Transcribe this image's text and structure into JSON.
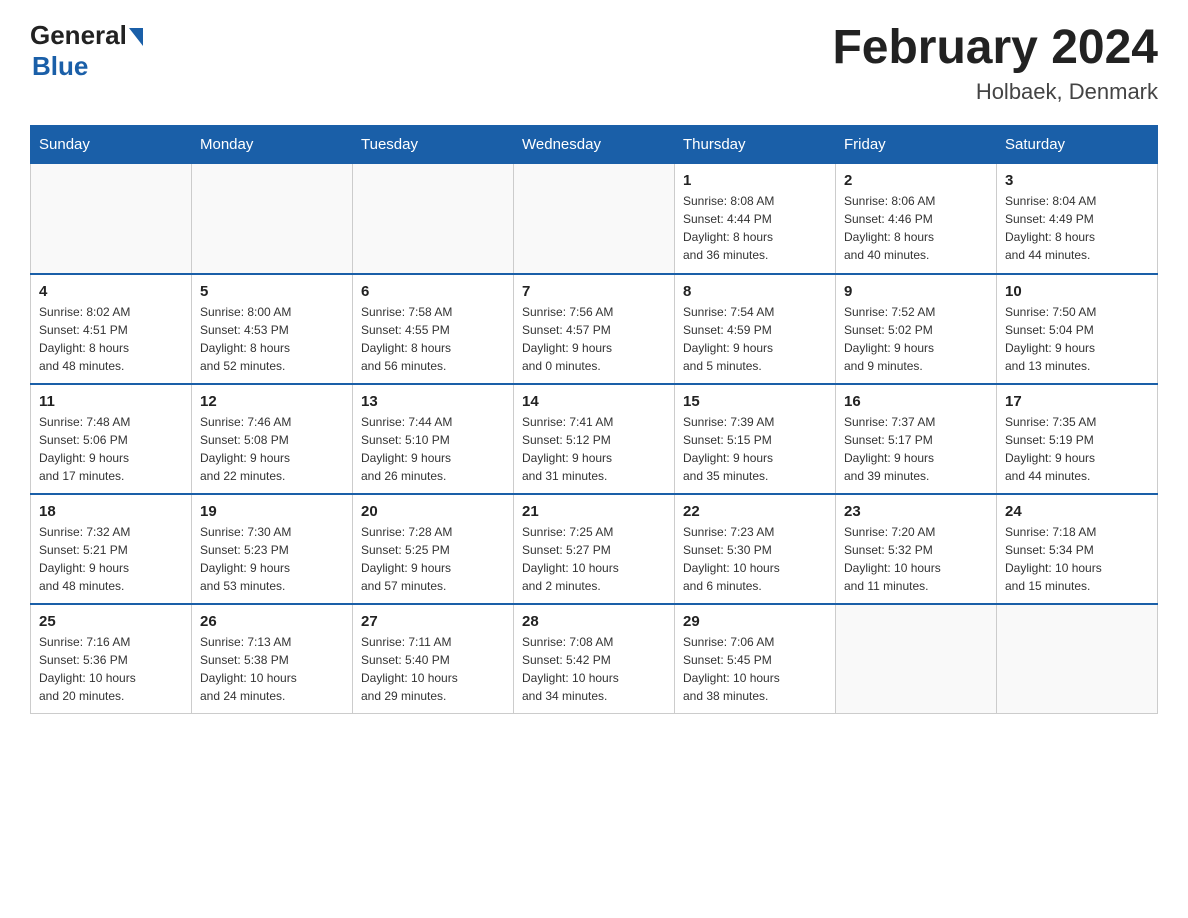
{
  "header": {
    "logo_general": "General",
    "logo_blue": "Blue",
    "title": "February 2024",
    "subtitle": "Holbaek, Denmark"
  },
  "weekdays": [
    "Sunday",
    "Monday",
    "Tuesday",
    "Wednesday",
    "Thursday",
    "Friday",
    "Saturday"
  ],
  "weeks": [
    [
      {
        "day": "",
        "info": ""
      },
      {
        "day": "",
        "info": ""
      },
      {
        "day": "",
        "info": ""
      },
      {
        "day": "",
        "info": ""
      },
      {
        "day": "1",
        "info": "Sunrise: 8:08 AM\nSunset: 4:44 PM\nDaylight: 8 hours\nand 36 minutes."
      },
      {
        "day": "2",
        "info": "Sunrise: 8:06 AM\nSunset: 4:46 PM\nDaylight: 8 hours\nand 40 minutes."
      },
      {
        "day": "3",
        "info": "Sunrise: 8:04 AM\nSunset: 4:49 PM\nDaylight: 8 hours\nand 44 minutes."
      }
    ],
    [
      {
        "day": "4",
        "info": "Sunrise: 8:02 AM\nSunset: 4:51 PM\nDaylight: 8 hours\nand 48 minutes."
      },
      {
        "day": "5",
        "info": "Sunrise: 8:00 AM\nSunset: 4:53 PM\nDaylight: 8 hours\nand 52 minutes."
      },
      {
        "day": "6",
        "info": "Sunrise: 7:58 AM\nSunset: 4:55 PM\nDaylight: 8 hours\nand 56 minutes."
      },
      {
        "day": "7",
        "info": "Sunrise: 7:56 AM\nSunset: 4:57 PM\nDaylight: 9 hours\nand 0 minutes."
      },
      {
        "day": "8",
        "info": "Sunrise: 7:54 AM\nSunset: 4:59 PM\nDaylight: 9 hours\nand 5 minutes."
      },
      {
        "day": "9",
        "info": "Sunrise: 7:52 AM\nSunset: 5:02 PM\nDaylight: 9 hours\nand 9 minutes."
      },
      {
        "day": "10",
        "info": "Sunrise: 7:50 AM\nSunset: 5:04 PM\nDaylight: 9 hours\nand 13 minutes."
      }
    ],
    [
      {
        "day": "11",
        "info": "Sunrise: 7:48 AM\nSunset: 5:06 PM\nDaylight: 9 hours\nand 17 minutes."
      },
      {
        "day": "12",
        "info": "Sunrise: 7:46 AM\nSunset: 5:08 PM\nDaylight: 9 hours\nand 22 minutes."
      },
      {
        "day": "13",
        "info": "Sunrise: 7:44 AM\nSunset: 5:10 PM\nDaylight: 9 hours\nand 26 minutes."
      },
      {
        "day": "14",
        "info": "Sunrise: 7:41 AM\nSunset: 5:12 PM\nDaylight: 9 hours\nand 31 minutes."
      },
      {
        "day": "15",
        "info": "Sunrise: 7:39 AM\nSunset: 5:15 PM\nDaylight: 9 hours\nand 35 minutes."
      },
      {
        "day": "16",
        "info": "Sunrise: 7:37 AM\nSunset: 5:17 PM\nDaylight: 9 hours\nand 39 minutes."
      },
      {
        "day": "17",
        "info": "Sunrise: 7:35 AM\nSunset: 5:19 PM\nDaylight: 9 hours\nand 44 minutes."
      }
    ],
    [
      {
        "day": "18",
        "info": "Sunrise: 7:32 AM\nSunset: 5:21 PM\nDaylight: 9 hours\nand 48 minutes."
      },
      {
        "day": "19",
        "info": "Sunrise: 7:30 AM\nSunset: 5:23 PM\nDaylight: 9 hours\nand 53 minutes."
      },
      {
        "day": "20",
        "info": "Sunrise: 7:28 AM\nSunset: 5:25 PM\nDaylight: 9 hours\nand 57 minutes."
      },
      {
        "day": "21",
        "info": "Sunrise: 7:25 AM\nSunset: 5:27 PM\nDaylight: 10 hours\nand 2 minutes."
      },
      {
        "day": "22",
        "info": "Sunrise: 7:23 AM\nSunset: 5:30 PM\nDaylight: 10 hours\nand 6 minutes."
      },
      {
        "day": "23",
        "info": "Sunrise: 7:20 AM\nSunset: 5:32 PM\nDaylight: 10 hours\nand 11 minutes."
      },
      {
        "day": "24",
        "info": "Sunrise: 7:18 AM\nSunset: 5:34 PM\nDaylight: 10 hours\nand 15 minutes."
      }
    ],
    [
      {
        "day": "25",
        "info": "Sunrise: 7:16 AM\nSunset: 5:36 PM\nDaylight: 10 hours\nand 20 minutes."
      },
      {
        "day": "26",
        "info": "Sunrise: 7:13 AM\nSunset: 5:38 PM\nDaylight: 10 hours\nand 24 minutes."
      },
      {
        "day": "27",
        "info": "Sunrise: 7:11 AM\nSunset: 5:40 PM\nDaylight: 10 hours\nand 29 minutes."
      },
      {
        "day": "28",
        "info": "Sunrise: 7:08 AM\nSunset: 5:42 PM\nDaylight: 10 hours\nand 34 minutes."
      },
      {
        "day": "29",
        "info": "Sunrise: 7:06 AM\nSunset: 5:45 PM\nDaylight: 10 hours\nand 38 minutes."
      },
      {
        "day": "",
        "info": ""
      },
      {
        "day": "",
        "info": ""
      }
    ]
  ]
}
